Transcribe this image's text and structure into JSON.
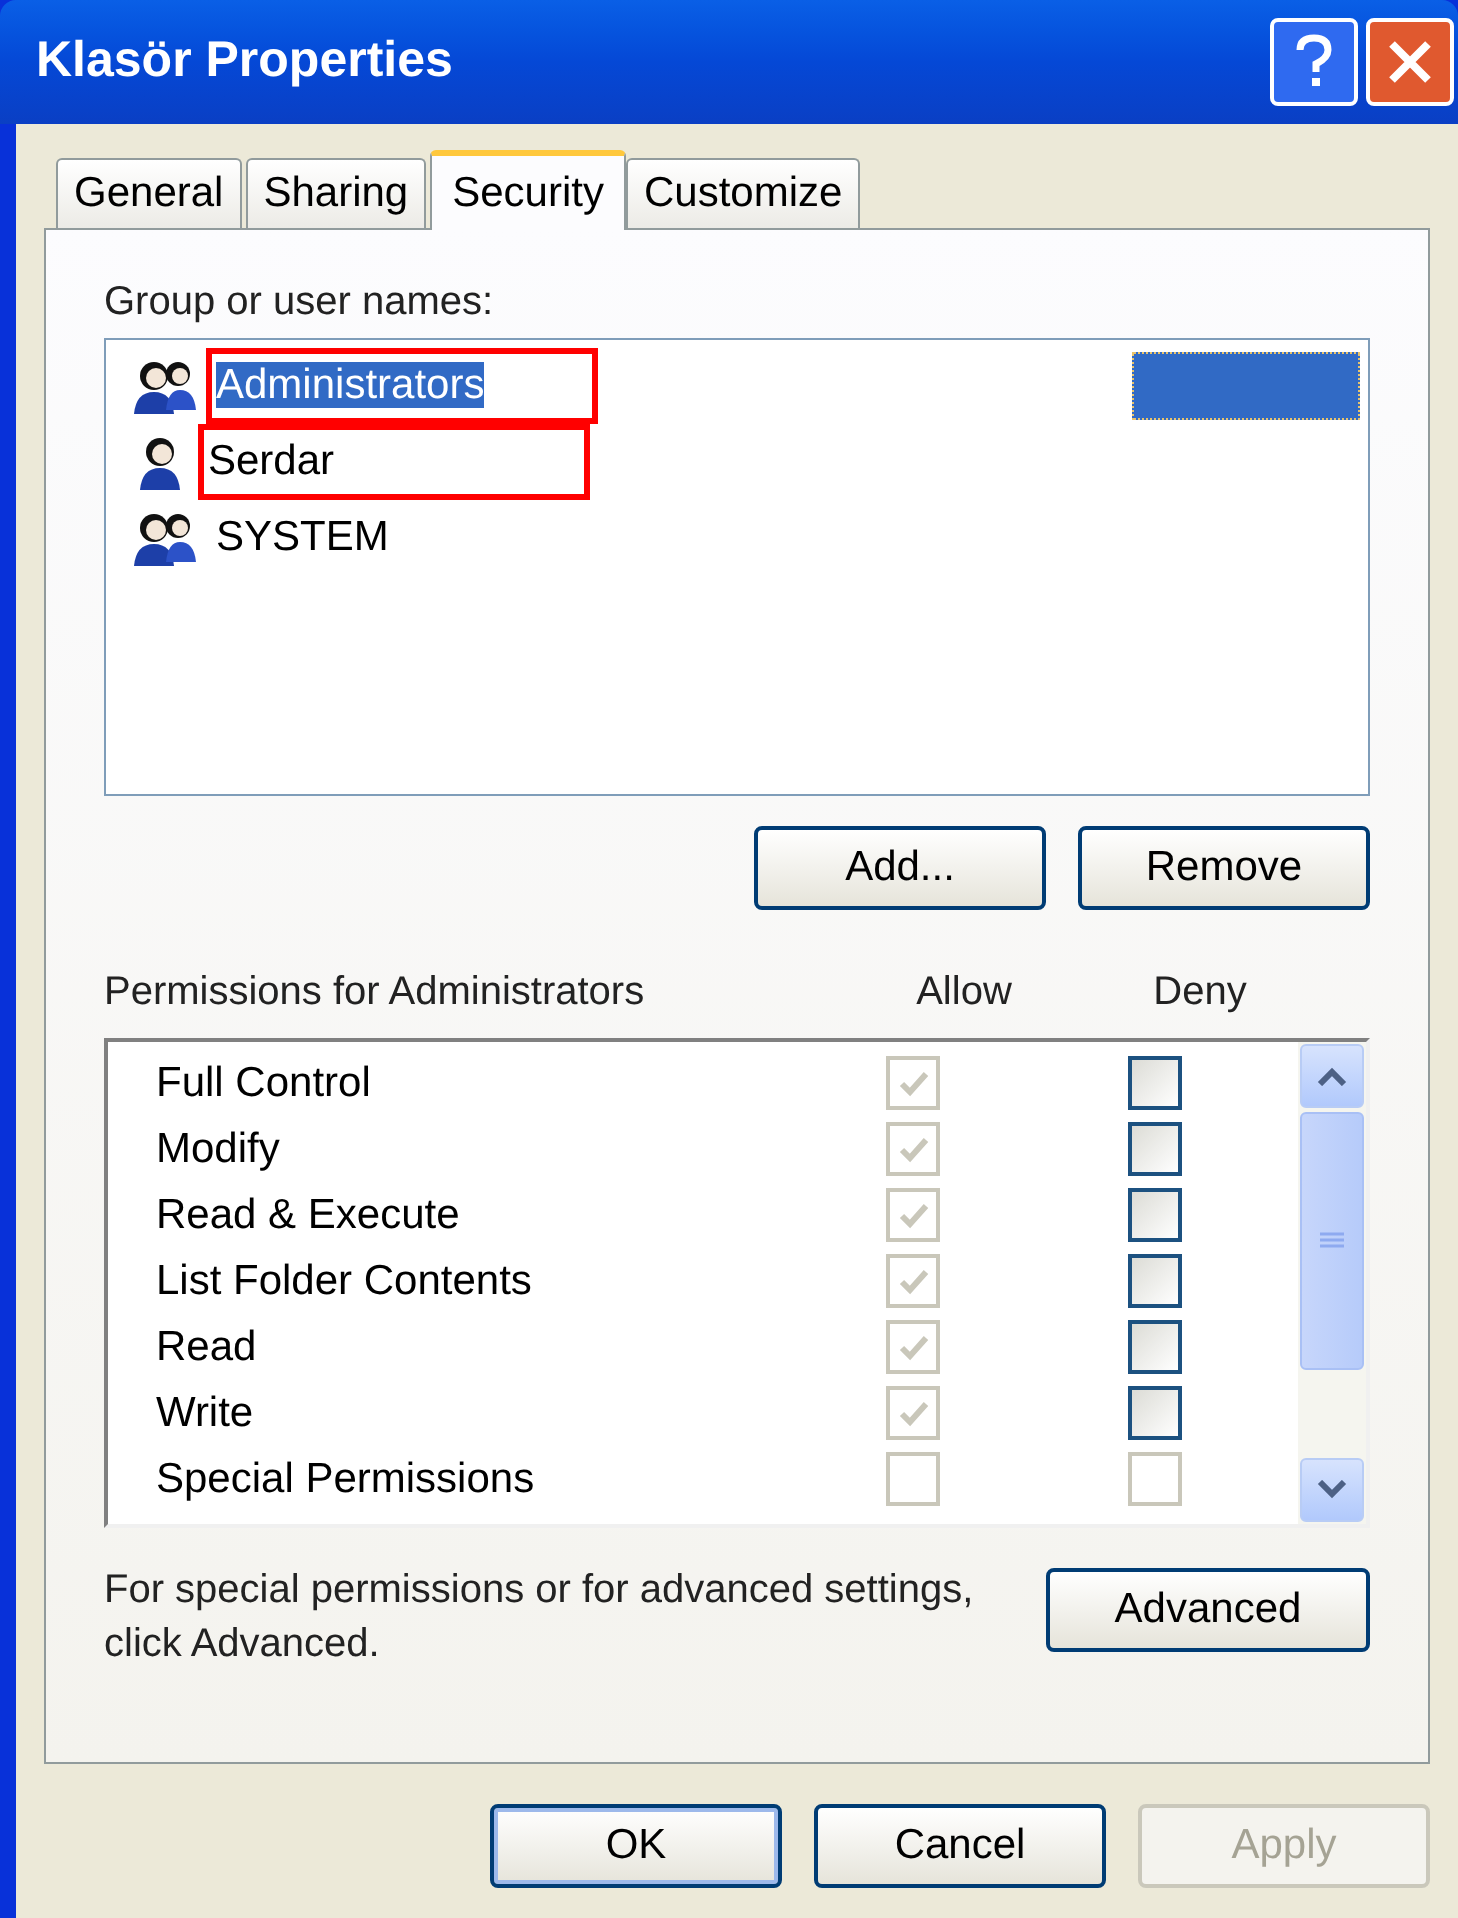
{
  "window": {
    "title": "Klasör Properties"
  },
  "tabs": [
    {
      "label": "General",
      "selected": false
    },
    {
      "label": "Sharing",
      "selected": false
    },
    {
      "label": "Security",
      "selected": true
    },
    {
      "label": "Customize",
      "selected": false
    }
  ],
  "names_label": "Group or user names:",
  "names": [
    {
      "name": "Administrators",
      "kind": "group",
      "selected": true,
      "outlined": true
    },
    {
      "name": "Serdar",
      "kind": "user",
      "selected": false,
      "outlined": true
    },
    {
      "name": "SYSTEM",
      "kind": "group",
      "selected": false,
      "outlined": false
    }
  ],
  "name_buttons": [
    "Add...",
    "Remove"
  ],
  "permissions_header": {
    "label": "Permissions for Administrators",
    "allow": "Allow",
    "deny": "Deny"
  },
  "permissions": [
    {
      "name": "Full Control",
      "allow": {
        "checked": true,
        "disabled": true
      },
      "deny": {
        "checked": false,
        "disabled": false
      }
    },
    {
      "name": "Modify",
      "allow": {
        "checked": true,
        "disabled": true
      },
      "deny": {
        "checked": false,
        "disabled": false
      }
    },
    {
      "name": "Read & Execute",
      "allow": {
        "checked": true,
        "disabled": true
      },
      "deny": {
        "checked": false,
        "disabled": false
      }
    },
    {
      "name": "List Folder Contents",
      "allow": {
        "checked": true,
        "disabled": true
      },
      "deny": {
        "checked": false,
        "disabled": false
      }
    },
    {
      "name": "Read",
      "allow": {
        "checked": true,
        "disabled": true
      },
      "deny": {
        "checked": false,
        "disabled": false
      }
    },
    {
      "name": "Write",
      "allow": {
        "checked": true,
        "disabled": true
      },
      "deny": {
        "checked": false,
        "disabled": false
      }
    },
    {
      "name": "Special Permissions",
      "allow": {
        "checked": false,
        "disabled": true
      },
      "deny": {
        "checked": false,
        "disabled": true
      }
    }
  ],
  "advanced_text": "For special permissions or for advanced settings, click Advanced.",
  "advanced_button": "Advanced",
  "footer_buttons": [
    {
      "label": "OK",
      "disabled": false,
      "default": true
    },
    {
      "label": "Cancel",
      "disabled": false,
      "default": false
    },
    {
      "label": "Apply",
      "disabled": true,
      "default": false
    }
  ]
}
